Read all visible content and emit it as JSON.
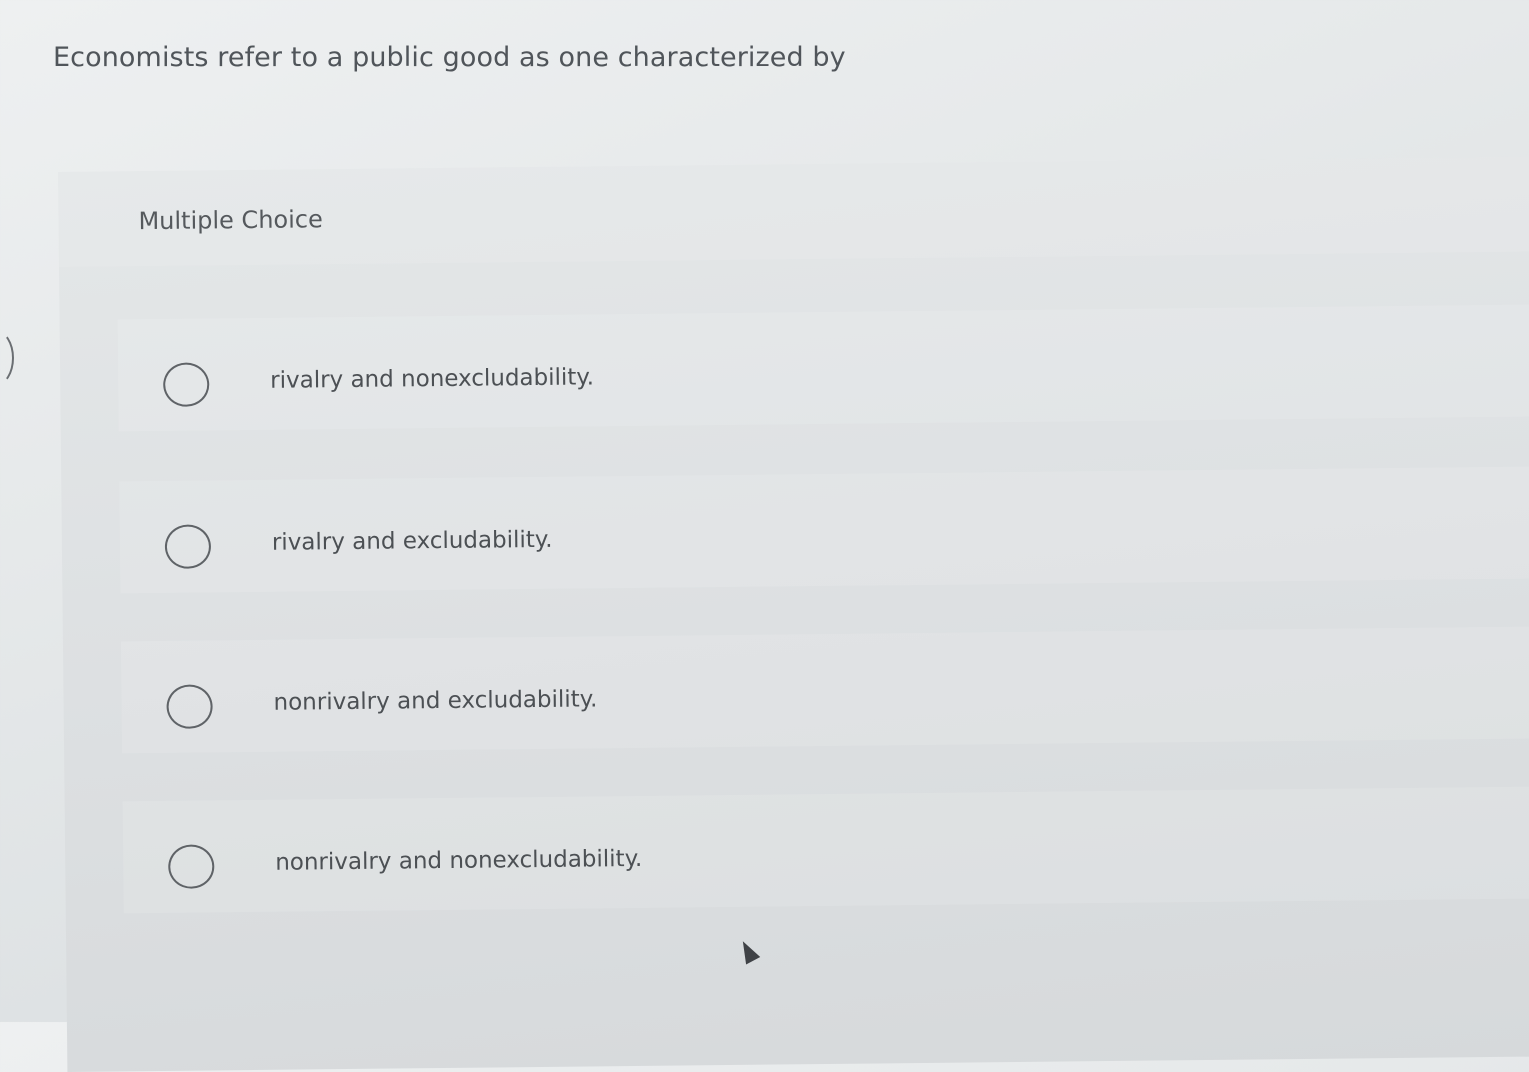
{
  "question": {
    "text": "Economists refer to a public good as one characterized by"
  },
  "choices": {
    "header": "Multiple Choice",
    "options": [
      {
        "label": "rivalry and nonexcludability.",
        "selected": false
      },
      {
        "label": "rivalry and excludability.",
        "selected": false
      },
      {
        "label": "nonrivalry and excludability.",
        "selected": false
      },
      {
        "label": "nonrivalry and nonexcludability.",
        "selected": false
      }
    ]
  },
  "icons": {
    "radio": "radio-button-empty-icon",
    "cursor": "mouse-pointer-icon"
  }
}
